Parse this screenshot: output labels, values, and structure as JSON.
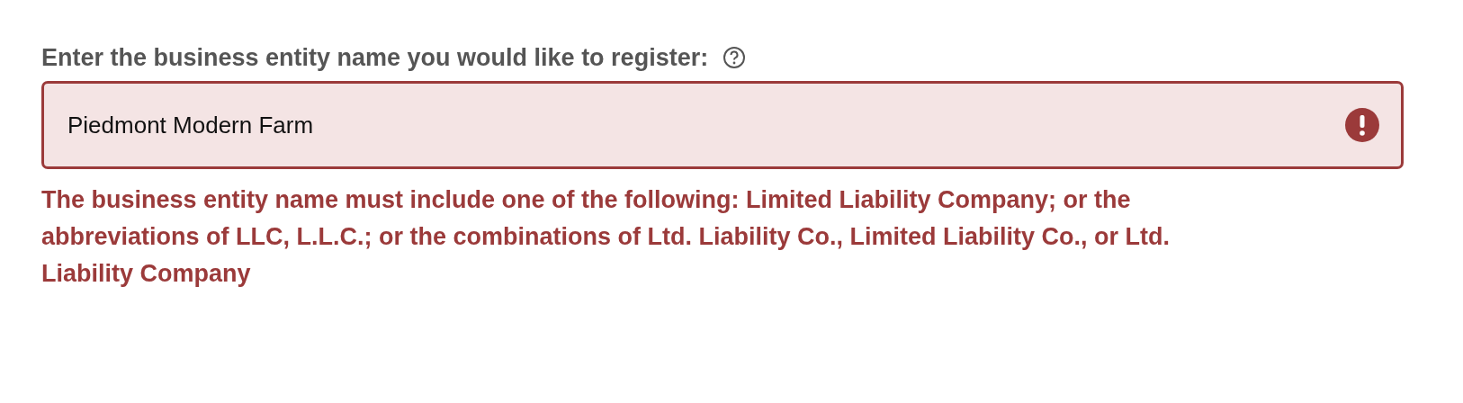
{
  "field": {
    "label": "Enter the business entity name you would like to register:",
    "value": "Piedmont Modern Farm",
    "invalid": true,
    "error": "The business entity name must include one of the following: Limited Liability Company; or the abbreviations of LLC, L.L.C.; or the combinations of Ltd. Liability Co., Limited Liability Co., or Ltd. Liability Company"
  }
}
